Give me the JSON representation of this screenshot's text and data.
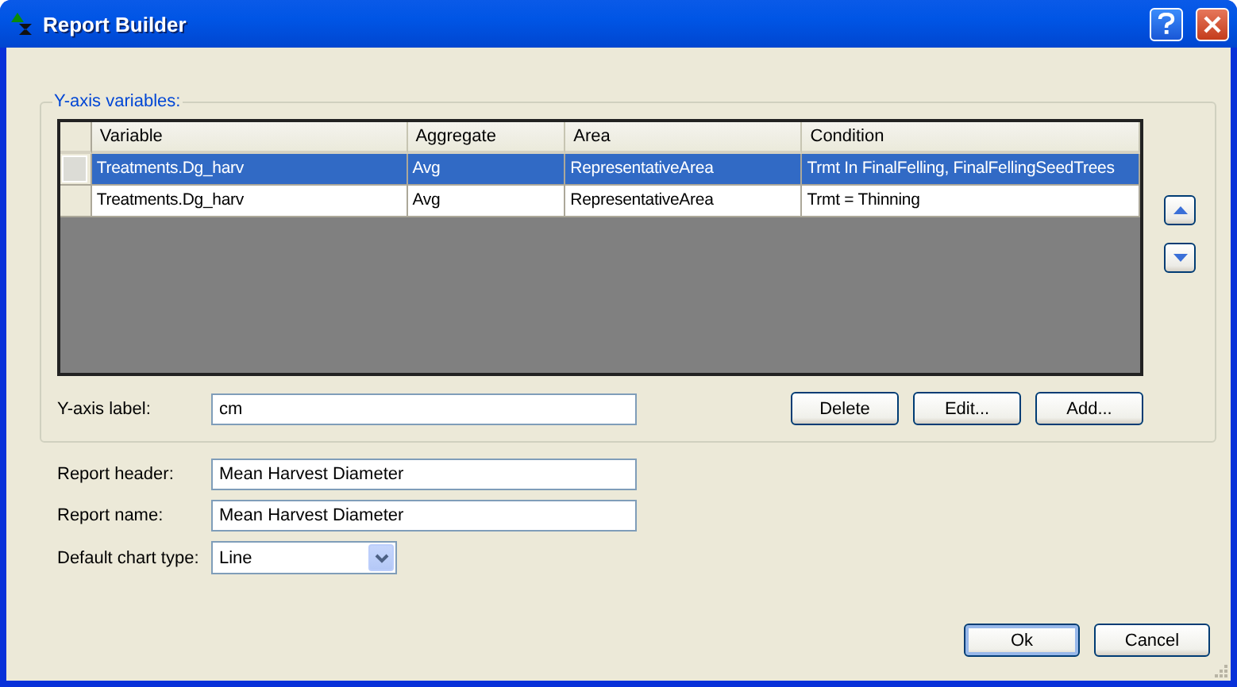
{
  "window": {
    "title": "Report Builder"
  },
  "y_axis_variables": {
    "title": "Y-axis variables:",
    "columns": [
      "Variable",
      "Aggregate",
      "Area",
      "Condition"
    ],
    "rows": [
      {
        "variable": "Treatments.Dg_harv",
        "aggregate": "Avg",
        "area": "RepresentativeArea",
        "condition": "Trmt In FinalFelling, FinalFellingSeedTrees",
        "selected": true
      },
      {
        "variable": "Treatments.Dg_harv",
        "aggregate": "Avg",
        "area": "RepresentativeArea",
        "condition": "Trmt = Thinning",
        "selected": false
      }
    ],
    "axis_label": {
      "label": "Y-axis label:",
      "value": "cm"
    },
    "buttons": [
      "Delete",
      "Edit...",
      "Add..."
    ]
  },
  "fields": [
    {
      "kind": "text",
      "label": "Report header:",
      "value": "Mean Harvest Diameter"
    },
    {
      "kind": "text",
      "label": "Report name:",
      "value": "Mean Harvest Diameter"
    },
    {
      "kind": "dropdown",
      "label": "Default chart type:",
      "value": "Line"
    }
  ],
  "buttons": [
    {
      "label": "Ok",
      "default": true
    },
    {
      "label": "Cancel",
      "default": false
    }
  ]
}
